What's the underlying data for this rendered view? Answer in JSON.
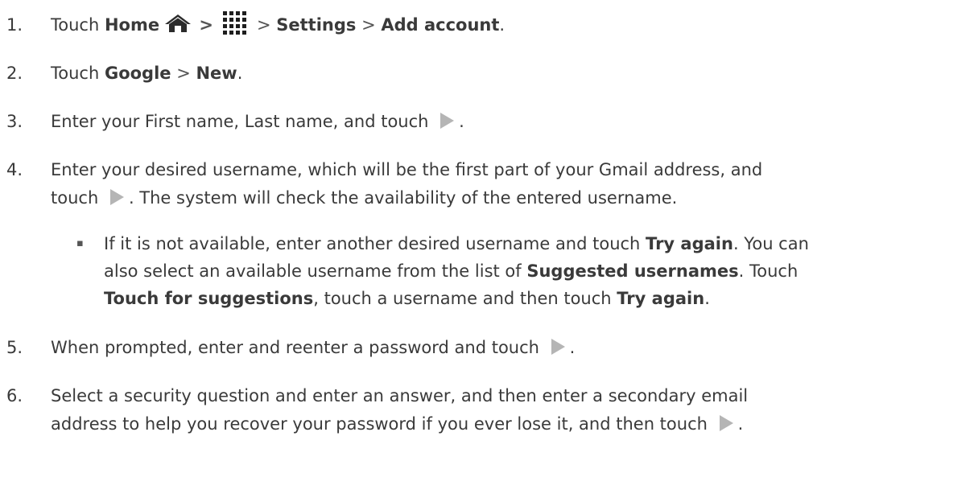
{
  "steps": [
    {
      "num": "1.",
      "parts": [
        "Touch ",
        "Home",
        " > ",
        " > ",
        "Settings",
        " > ",
        "Add account",
        "."
      ]
    },
    {
      "num": "2.",
      "parts": [
        "Touch ",
        "Google",
        " > ",
        "New",
        "."
      ]
    },
    {
      "num": "3.",
      "parts": [
        "Enter your First name, Last name, and touch ",
        "."
      ]
    },
    {
      "num": "4.",
      "line1": "Enter your desired username, which will be the first part of your Gmail address, and",
      "line2_a": "touch ",
      "line2_b": ". The system will check the availability of the entered username."
    },
    {
      "num": "5.",
      "parts": [
        "When prompted, enter and reenter a password and touch ",
        "."
      ]
    },
    {
      "num": "6.",
      "line1": "Select a security question and enter an answer, and then enter a secondary email",
      "line2_a": "address to help you recover your password if you ever lose it, and then touch ",
      "line2_b": "."
    }
  ],
  "sub": {
    "bullet": "▪",
    "l1": [
      "If it is not available, enter another desired username and touch ",
      "Try again",
      ". You can"
    ],
    "l2": [
      "also select an available username from the list of ",
      "Suggested usernames",
      ". Touch"
    ],
    "l3": [
      "Touch for suggestions",
      ", touch a username and then touch ",
      "Try again",
      "."
    ]
  },
  "icons": {
    "home": "home-icon",
    "apps": "apps-grid-icon",
    "next": "play-arrow-icon"
  },
  "colors": {
    "text": "#3a3a3a",
    "icon": "#2b2b2b",
    "arrow": "#b5b5b5"
  }
}
